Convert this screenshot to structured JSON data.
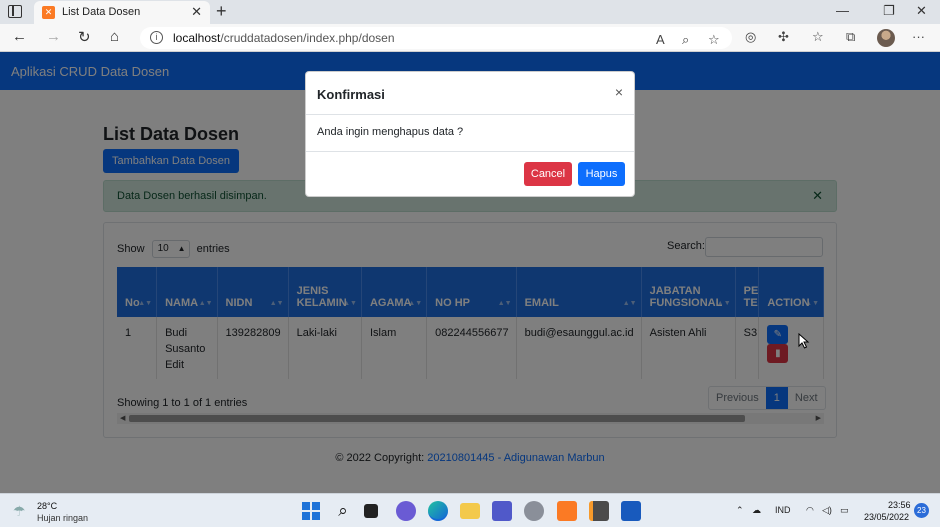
{
  "browser": {
    "tab_title": "List Data Dosen",
    "url_host": "localhost",
    "url_path": "/cruddatadosen/index.php/dosen"
  },
  "navbar": {
    "brand": "Aplikasi CRUD Data Dosen"
  },
  "page": {
    "title": "List Data Dosen",
    "add_button": "Tambahkan Data Dosen",
    "alert": "Data Dosen berhasil disimpan.",
    "show_label": "Show",
    "entries_value": "10",
    "entries_label": "entries",
    "search_label": "Search:"
  },
  "table": {
    "columns": [
      "No",
      "NAMA",
      "NIDN",
      "JENIS KELAMIN",
      "AGAMA",
      "NO HP",
      "EMAIL",
      "JABATAN FUNGSIONAL",
      "PE TE",
      "ACTION"
    ],
    "columns_display": {
      "no": "No",
      "nama": "NAMA",
      "nidn": "NIDN",
      "jk_1": "JENIS",
      "jk_2": "KELAMIN",
      "agama": "AGAMA",
      "nohp": "NO HP",
      "email": "EMAIL",
      "jab_1": "JABATAN",
      "jab_2": "FUNGSIONAL",
      "pe_1": "PE",
      "pe_2": "TE",
      "action": "ACTION"
    },
    "rows": [
      {
        "no": "1",
        "nama_1": "Budi",
        "nama_2": "Susanto",
        "nama_3": "Edit",
        "nidn": "139282809",
        "jk": "Laki-laki",
        "agama": "Islam",
        "nohp": "082244556677",
        "email": "budi@esaunggul.ac.id",
        "jabatan": "Asisten Ahli",
        "pe": "S3"
      }
    ],
    "info": "Showing 1 to 1 of 1 entries",
    "pagination": {
      "prev": "Previous",
      "current": "1",
      "next": "Next"
    }
  },
  "footer": {
    "prefix": "© 2022 Copyright:",
    "link": "20210801445 - Adigunawan Marbun"
  },
  "modal": {
    "title": "Konfirmasi",
    "close": "×",
    "body": "Anda ingin menghapus data ?",
    "cancel": "Cancel",
    "confirm": "Hapus"
  },
  "taskbar": {
    "temperature": "28°C",
    "weather": "Hujan ringan",
    "language": "IND",
    "time": "23:56",
    "date": "23/05/2022",
    "notifications": "23"
  },
  "colors": {
    "primary": "#0d6efd",
    "danger": "#dc3545",
    "success_bg": "#d1e7dd"
  }
}
